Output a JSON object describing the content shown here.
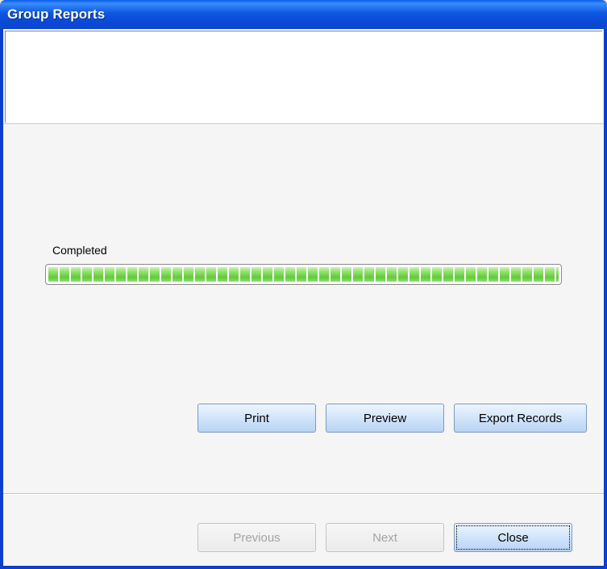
{
  "window": {
    "title": "Group Reports"
  },
  "progress": {
    "label": "Completed",
    "fraction": 1.0
  },
  "actions": {
    "print_label": "Print",
    "preview_label": "Preview",
    "export_label": "Export Records"
  },
  "navigation": {
    "previous_label": "Previous",
    "next_label": "Next",
    "close_label": "Close"
  },
  "colors": {
    "titlebar": "#0a49d6",
    "progress_fill": "#5fcb3a",
    "button_face": "#d4e6fb"
  }
}
